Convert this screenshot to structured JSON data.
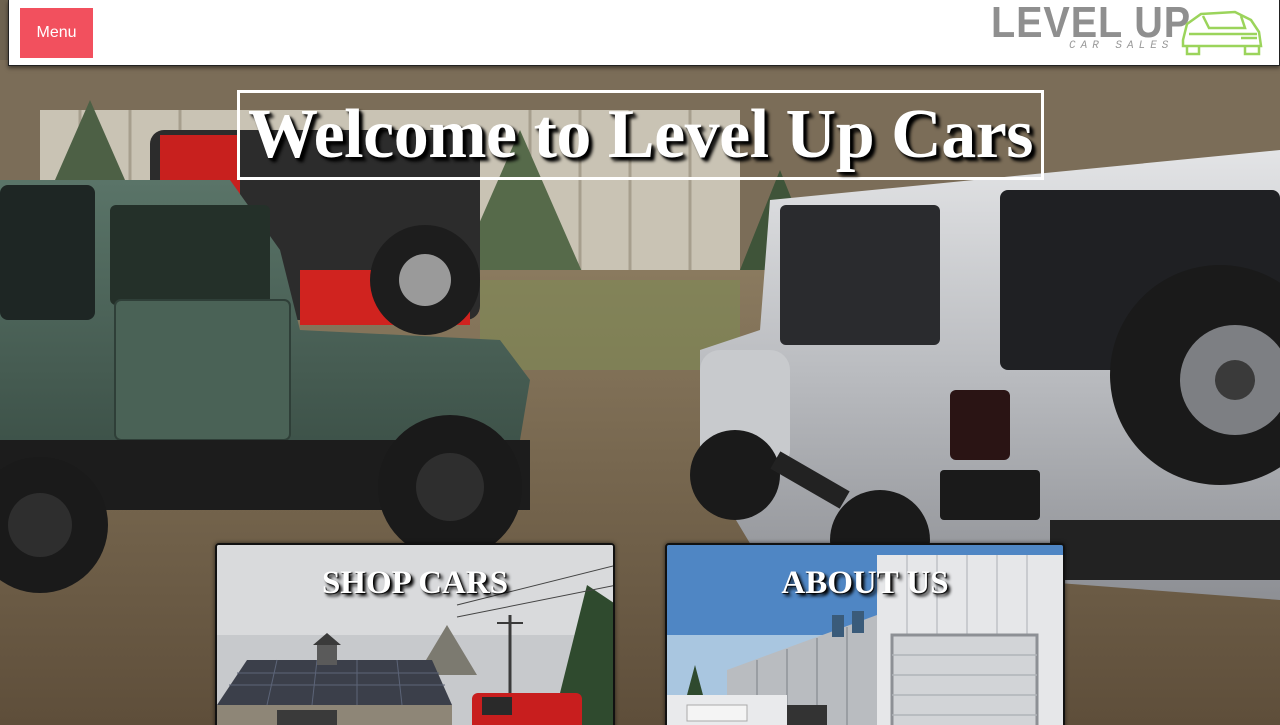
{
  "nav": {
    "menu_label": "Menu"
  },
  "logo": {
    "main": "LEVEL UP",
    "sub": "CAR SALES"
  },
  "hero": {
    "title": "Welcome to Level Up Cars"
  },
  "cards": [
    {
      "label": "SHOP CARS"
    },
    {
      "label": "ABOUT US"
    }
  ],
  "colors": {
    "menu_button": "#f2505e",
    "logo_gray": "#8f8f8f",
    "logo_green": "#9bd45b"
  }
}
